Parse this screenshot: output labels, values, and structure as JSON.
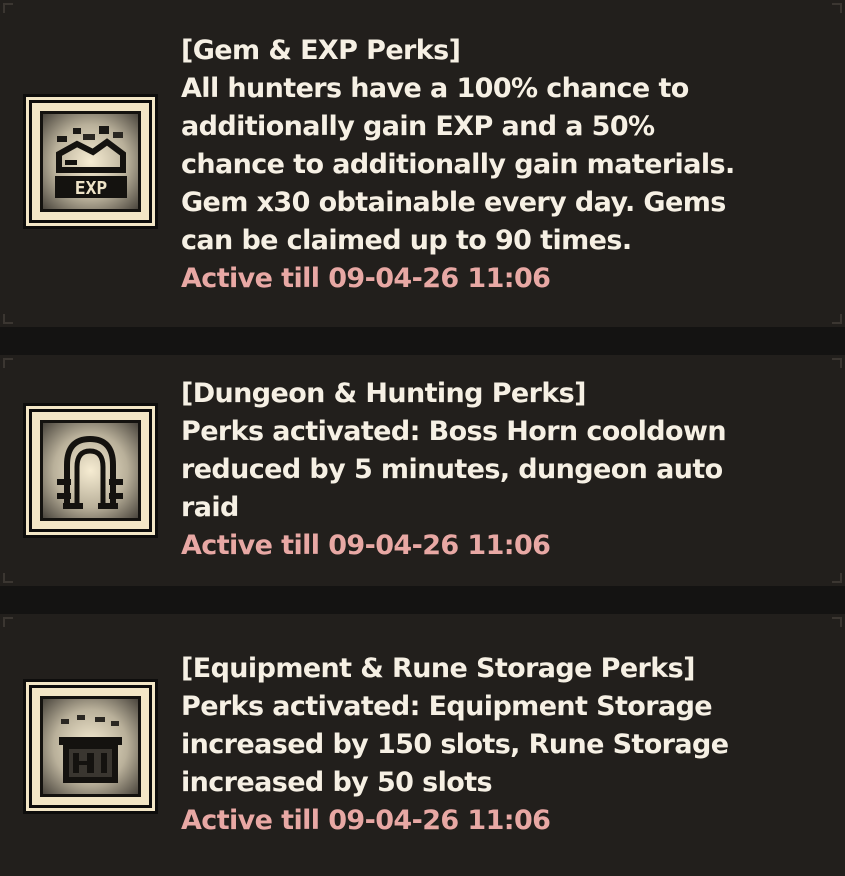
{
  "perks": [
    {
      "icon": "exp-ticket-icon",
      "lines": [
        "[Gem & EXP Perks]",
        "All hunters have a 100% chance to",
        "additionally gain EXP and a 50%",
        "chance to additionally gain materials.",
        "Gem x30 obtainable every day. Gems",
        "can be claimed up to 90 times."
      ],
      "icon_label": "EXP",
      "active": "Active till 09-04-26 11:06"
    },
    {
      "icon": "horn-arch-icon",
      "lines": [
        "[Dungeon & Hunting Perks]",
        "Perks activated: Boss Horn cooldown",
        "reduced by 5 minutes, dungeon auto",
        "raid"
      ],
      "active": "Active till 09-04-26 11:06"
    },
    {
      "icon": "storage-chest-icon",
      "lines": [
        "[Equipment & Rune Storage Perks]",
        "Perks activated: Equipment Storage",
        "increased by 150 slots, Rune Storage",
        "increased by 50 slots"
      ],
      "active": "Active till 09-04-26 11:06"
    }
  ],
  "colors": {
    "card_background": "#221f1c",
    "text": "#f6f0e4",
    "active_text": "#e8a8a4",
    "icon_frame": "#f3e6c6"
  }
}
